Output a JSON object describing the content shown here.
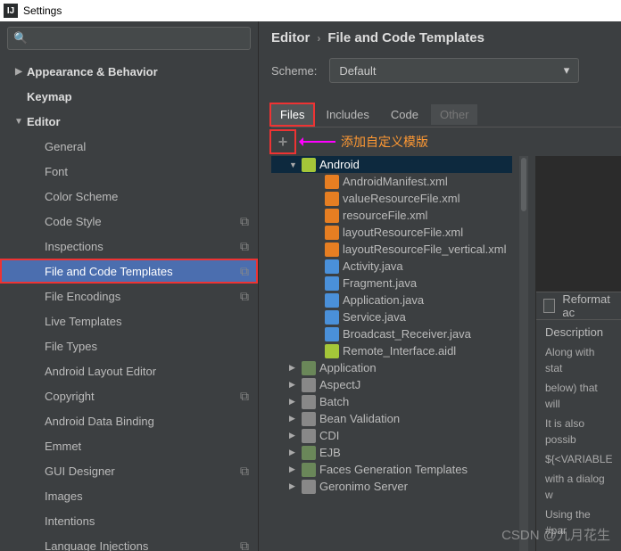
{
  "window": {
    "title": "Settings"
  },
  "breadcrumb": {
    "a": "Editor",
    "b": "File and Code Templates"
  },
  "scheme": {
    "label": "Scheme:",
    "value": "Default"
  },
  "tabs": {
    "files": "Files",
    "includes": "Includes",
    "code": "Code",
    "other": "Other"
  },
  "annot": {
    "text": "添加自定义模版"
  },
  "sidebar": {
    "items": [
      {
        "label": "Appearance & Behavior",
        "bold": true,
        "chev": "▶"
      },
      {
        "label": "Keymap",
        "bold": true
      },
      {
        "label": "Editor",
        "bold": true,
        "chev": "▼"
      },
      {
        "label": "General",
        "level": 1,
        "chev": "▶"
      },
      {
        "label": "Font",
        "level": 1
      },
      {
        "label": "Color Scheme",
        "level": 1,
        "chev": "▶"
      },
      {
        "label": "Code Style",
        "level": 1,
        "chev": "▶",
        "copy": true
      },
      {
        "label": "Inspections",
        "level": 1,
        "copy": true
      },
      {
        "label": "File and Code Templates",
        "level": 1,
        "selected": true,
        "hl": true,
        "copy": true
      },
      {
        "label": "File Encodings",
        "level": 1,
        "copy": true
      },
      {
        "label": "Live Templates",
        "level": 1
      },
      {
        "label": "File Types",
        "level": 1
      },
      {
        "label": "Android Layout Editor",
        "level": 1
      },
      {
        "label": "Copyright",
        "level": 1,
        "chev": "▶",
        "copy": true
      },
      {
        "label": "Android Data Binding",
        "level": 1
      },
      {
        "label": "Emmet",
        "level": 1,
        "chev": "▶"
      },
      {
        "label": "GUI Designer",
        "level": 1,
        "copy": true
      },
      {
        "label": "Images",
        "level": 1
      },
      {
        "label": "Intentions",
        "level": 1
      },
      {
        "label": "Language Injections",
        "level": 1,
        "chev": "▶",
        "copy": true
      }
    ]
  },
  "filetree": {
    "root": {
      "label": "Android",
      "open": true,
      "sel": true
    },
    "android_children": [
      {
        "label": "AndroidManifest.xml",
        "ico": "xml"
      },
      {
        "label": "valueResourceFile.xml",
        "ico": "xml"
      },
      {
        "label": "resourceFile.xml",
        "ico": "xml"
      },
      {
        "label": "layoutResourceFile.xml",
        "ico": "xml"
      },
      {
        "label": "layoutResourceFile_vertical.xml",
        "ico": "xml"
      },
      {
        "label": "Activity.java",
        "ico": "java"
      },
      {
        "label": "Fragment.java",
        "ico": "java"
      },
      {
        "label": "Application.java",
        "ico": "java"
      },
      {
        "label": "Service.java",
        "ico": "java"
      },
      {
        "label": "Broadcast_Receiver.java",
        "ico": "java"
      },
      {
        "label": "Remote_Interface.aidl",
        "ico": "android"
      }
    ],
    "siblings": [
      {
        "label": "Application",
        "ico": "folder"
      },
      {
        "label": "AspectJ",
        "ico": "gen"
      },
      {
        "label": "Batch",
        "ico": "gen"
      },
      {
        "label": "Bean Validation",
        "ico": "gen"
      },
      {
        "label": "CDI",
        "ico": "gen"
      },
      {
        "label": "EJB",
        "ico": "folder"
      },
      {
        "label": "Faces Generation Templates",
        "ico": "folder"
      },
      {
        "label": "Geronimo Server",
        "ico": "gen"
      }
    ]
  },
  "right": {
    "reformat": "Reformat ac",
    "desc_head": "Description",
    "desc": {
      "l1": "Along with stat",
      "l2": "below) that will",
      "l3": "It is also possib",
      "l4": "${<VARIABLE",
      "l5": "with a dialog w",
      "l6": "Using the #par"
    }
  },
  "watermark": "CSDN @九月花生"
}
